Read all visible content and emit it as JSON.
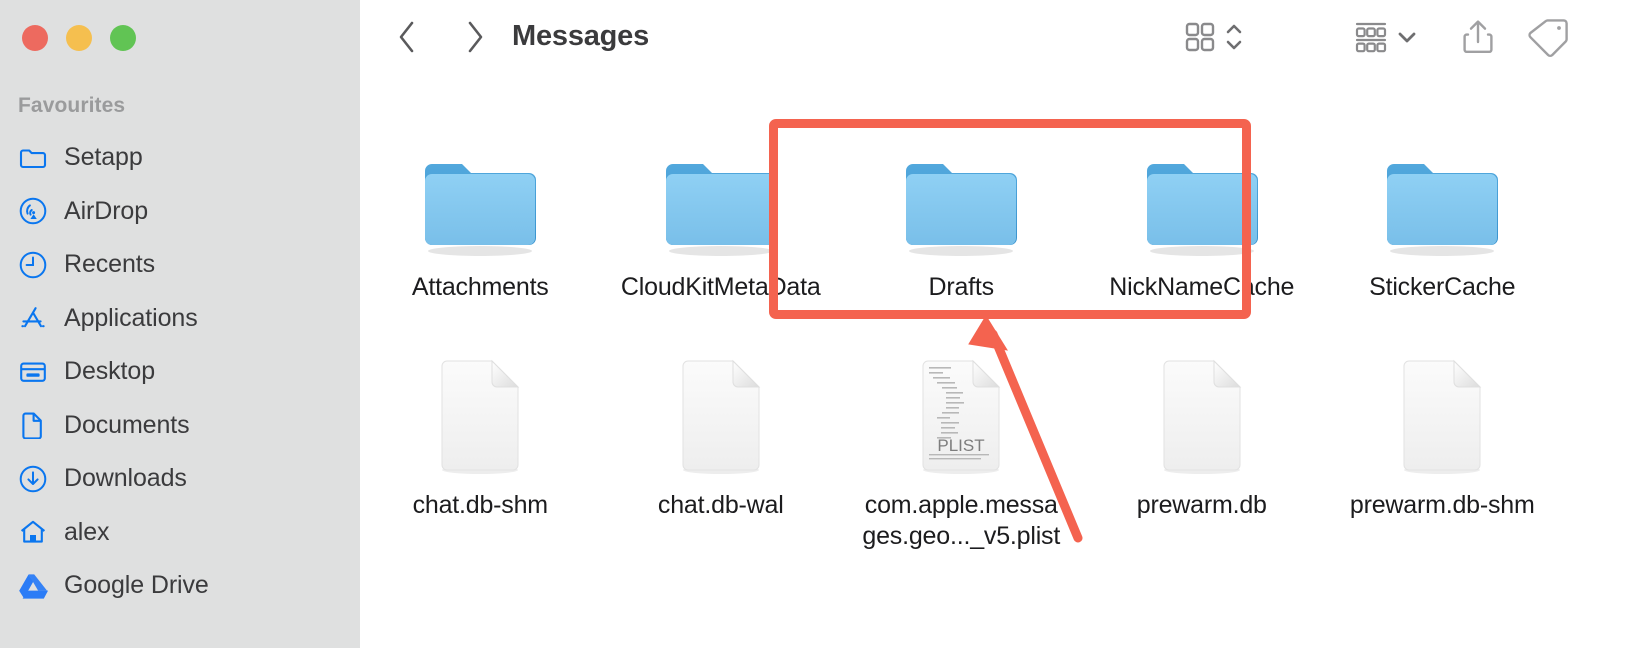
{
  "window": {
    "title": "Messages",
    "traffic_lights": [
      {
        "name": "close",
        "color": "#ed6a5f"
      },
      {
        "name": "minimize",
        "color": "#f5bf4f"
      },
      {
        "name": "zoom",
        "color": "#61c454"
      }
    ]
  },
  "sidebar": {
    "section_title": "Favourites",
    "background": "#dfe0e0",
    "accent": "#0a76ef",
    "items": [
      {
        "label": "Setapp",
        "icon": "folder-icon"
      },
      {
        "label": "AirDrop",
        "icon": "airdrop-icon"
      },
      {
        "label": "Recents",
        "icon": "clock-icon"
      },
      {
        "label": "Applications",
        "icon": "applications-icon"
      },
      {
        "label": "Desktop",
        "icon": "desktop-icon"
      },
      {
        "label": "Documents",
        "icon": "document-icon"
      },
      {
        "label": "Downloads",
        "icon": "download-icon"
      },
      {
        "label": "alex",
        "icon": "home-icon"
      },
      {
        "label": "Google Drive",
        "icon": "google-drive-icon"
      }
    ]
  },
  "toolbar": {
    "back_icon": "chevron-left-icon",
    "forward_icon": "chevron-right-icon",
    "view_mode_icon": "icon-view-grid-icon",
    "view_mode_chevron": "chevron-up-down-icon",
    "group_by_icon": "group-by-rows-icon",
    "group_by_chevron": "chevron-down-icon",
    "share_icon": "share-icon",
    "tags_icon": "tag-icon"
  },
  "files": [
    {
      "name": "Attachments",
      "type": "folder",
      "row": 1
    },
    {
      "name": "CloudKitMetaData",
      "type": "folder",
      "row": 1
    },
    {
      "name": "Drafts",
      "type": "folder",
      "row": 1
    },
    {
      "name": "NickNameCache",
      "type": "folder",
      "row": 1
    },
    {
      "name": "StickerCache",
      "type": "folder",
      "row": 1
    },
    {
      "name": "chat.db-shm",
      "type": "document",
      "row": 2
    },
    {
      "name": "chat.db-wal",
      "type": "document",
      "row": 2
    },
    {
      "name": "com.apple.messages.geo..._v5.plist",
      "type": "plist",
      "row": 2,
      "badge": "PLIST"
    },
    {
      "name": "prewarm.db",
      "type": "document",
      "row": 2
    },
    {
      "name": "prewarm.db-shm",
      "type": "document",
      "row": 2
    }
  ],
  "annotations": {
    "color": "#f4634f",
    "highlight_box": "rectangle around Attachments and CloudKitMetaData",
    "arrow": "arrow pointing up-left to highlighted folders"
  },
  "colors": {
    "folder_front": "#83c8f0",
    "folder_back": "#3e9bd5",
    "document_face": "#f3f3f3",
    "text": "#1c1c1e"
  }
}
